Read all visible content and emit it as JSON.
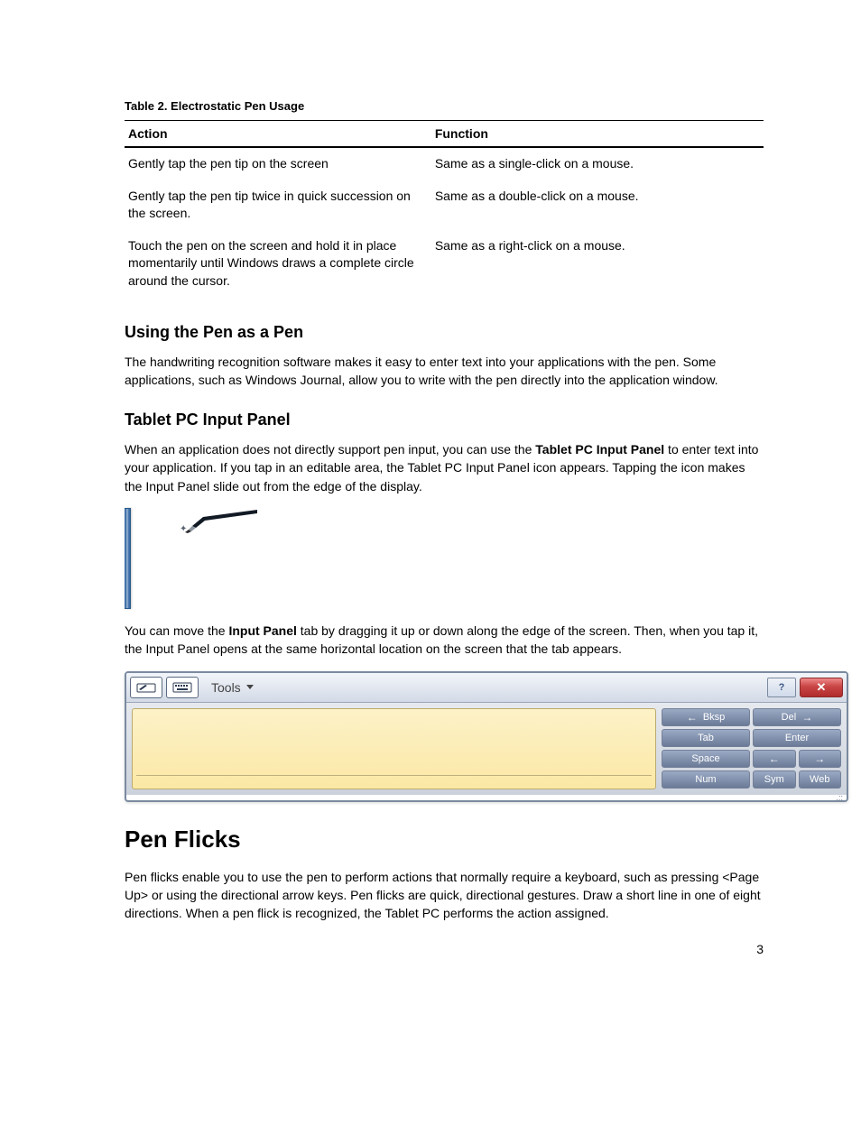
{
  "table": {
    "caption": "Table 2. Electrostatic Pen Usage",
    "headers": {
      "action": "Action",
      "function": "Function"
    },
    "rows": [
      {
        "action": "Gently tap the pen tip on the screen",
        "function": "Same as a single-click on a mouse."
      },
      {
        "action": "Gently tap the pen tip twice in quick succession on the screen.",
        "function": "Same as a double-click on a mouse."
      },
      {
        "action": "Touch the pen on the screen and hold it in place momentarily until Windows draws a complete circle around the cursor.",
        "function": "Same as a right-click on a mouse."
      }
    ]
  },
  "section_pen_as_pen": {
    "heading": "Using the Pen as a Pen",
    "body": "The handwriting recognition software makes it easy to enter text into your applications with the pen. Some applications, such as Windows Journal, allow you to write with the pen directly into the application window."
  },
  "section_input_panel": {
    "heading": "Tablet PC Input Panel",
    "para1_pre": "When an application does not directly support pen input, you can use the ",
    "para1_bold1": "Tablet PC Input Panel",
    "para1_post": " to enter text into your application. If you tap in an editable area, the Tablet PC Input Panel icon appears. Tapping the icon makes the Input Panel slide out from the edge of the display.",
    "para2_pre": "You can move the ",
    "para2_bold": "Input Panel",
    "para2_post": " tab by dragging it up or down along the edge of the screen. Then, when you tap it, the Input Panel opens at the same horizontal location on the screen that the tab appears."
  },
  "input_panel_ui": {
    "tools_label": "Tools",
    "help_label": "?",
    "close_label": "✕",
    "keys": {
      "bksp": "Bksp",
      "del": "Del",
      "tab": "Tab",
      "enter": "Enter",
      "space": "Space",
      "left": "←",
      "right": "→",
      "bksp_arrow": "←",
      "del_arrow": "→",
      "num": "Num",
      "sym": "Sym",
      "web": "Web"
    }
  },
  "section_pen_flicks": {
    "heading": "Pen Flicks",
    "body": "Pen flicks enable you to use the pen to perform actions that normally require a keyboard, such as pressing <Page Up> or using the directional arrow keys. Pen flicks are quick, directional gestures. Draw a short line in one of eight directions. When a pen flick is recognized, the Tablet PC performs the action assigned."
  },
  "page_number": "3"
}
